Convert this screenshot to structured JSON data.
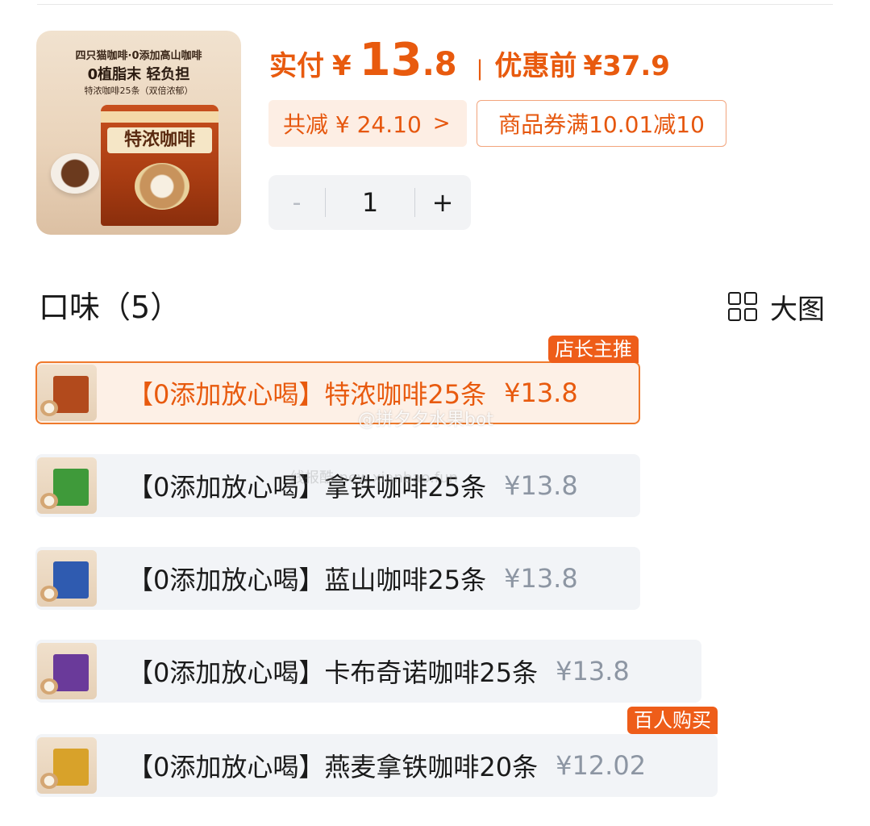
{
  "product": {
    "image_text": {
      "line1": "四只猫咖啡·0添加高山咖啡",
      "line2": "0植脂末 轻负担",
      "line3": "特浓咖啡25条（双倍浓郁）",
      "bag_name": "特浓咖啡"
    }
  },
  "price": {
    "paid_label": "实付",
    "currency": "¥",
    "paid_int": "13",
    "paid_dec": ".8",
    "separator": "|",
    "before_label": "优惠前",
    "before_value": "¥37.9",
    "discount_text": "共减 ¥ 24.10",
    "discount_chevron": ">",
    "coupon_text": "商品券满10.01减10"
  },
  "stepper": {
    "minus": "-",
    "quantity": "1",
    "plus": "+"
  },
  "flavors": {
    "title": "口味（5）",
    "big_image_label": "大图",
    "options": [
      {
        "label": "【0添加放心喝】特浓咖啡25条",
        "price": "¥13.8",
        "badge": "店长主推",
        "selected": true,
        "bag_color": "#b24a1c"
      },
      {
        "label": "【0添加放心喝】拿铁咖啡25条",
        "price": "¥13.8",
        "badge": "",
        "selected": false,
        "bag_color": "#3f9a3a"
      },
      {
        "label": "【0添加放心喝】蓝山咖啡25条",
        "price": "¥13.8",
        "badge": "",
        "selected": false,
        "bag_color": "#2f5bb0"
      },
      {
        "label": "【0添加放心喝】卡布奇诺咖啡25条",
        "price": "¥13.8",
        "badge": "",
        "selected": false,
        "bag_color": "#6a3a9a"
      },
      {
        "label": "【0添加放心喝】燕麦拿铁咖啡20条",
        "price": "¥12.02",
        "badge": "百人购买",
        "selected": false,
        "bag_color": "#d8a22a"
      }
    ]
  },
  "watermarks": {
    "weibo": "@拼夕夕水果bot",
    "site": "线报酷-new.xianbao.fun"
  },
  "colors": {
    "accent": "#e85a0e",
    "badge": "#ee5d19",
    "option_bg": "#f2f4f7",
    "muted_price": "#8d96a3"
  }
}
